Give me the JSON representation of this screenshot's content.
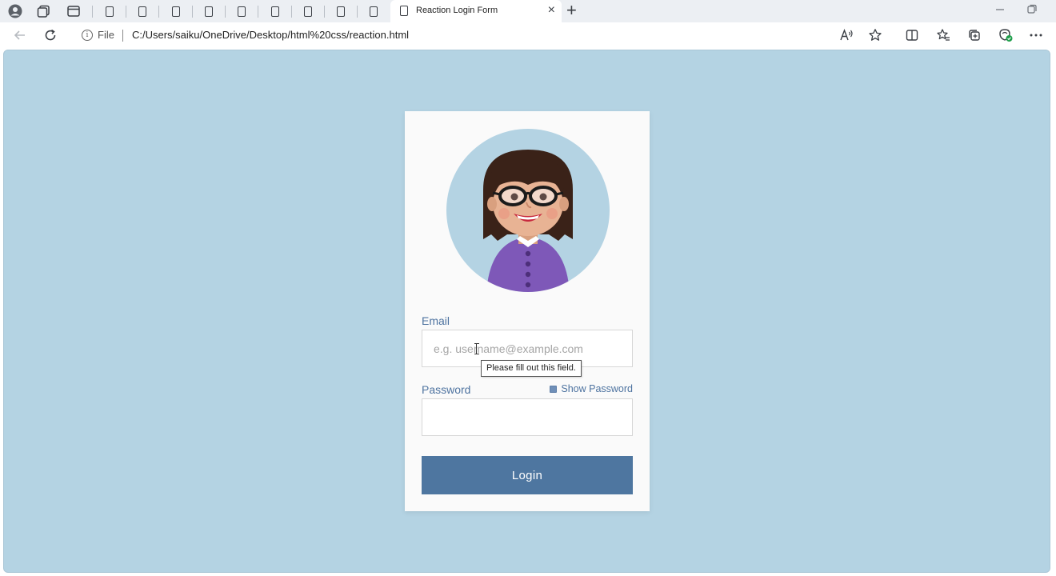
{
  "browser": {
    "active_tab_title": "Reaction Login Form",
    "tab_close_glyph": "×",
    "new_tab_glyph": "+",
    "address_scheme_label": "File",
    "url": "C:/Users/saiku/OneDrive/Desktop/html%20css/reaction.html",
    "icons": [
      "profile-icon",
      "workspaces-icon",
      "tab-actions-icon",
      "page-icon",
      "back-icon",
      "refresh-icon",
      "info-icon",
      "read-aloud-icon",
      "favorite-star-icon",
      "split-screen-icon",
      "favorites-icon",
      "collections-icon",
      "browser-essentials-icon",
      "more-icon",
      "minimize-icon",
      "restore-icon"
    ]
  },
  "colors": {
    "page_background": "#b4d3e3",
    "card_background": "#fafafa",
    "label_color": "#4e73a0",
    "button_color": "#4e76a0",
    "hair": "#3a2218",
    "skin": "#e8b394",
    "shirt": "#7e58b8"
  },
  "form": {
    "email_label": "Email",
    "email_placeholder": "e.g. username@example.com",
    "validation_tooltip": "Please fill out this field.",
    "password_label": "Password",
    "show_password_label": "Show Password",
    "login_button": "Login"
  }
}
